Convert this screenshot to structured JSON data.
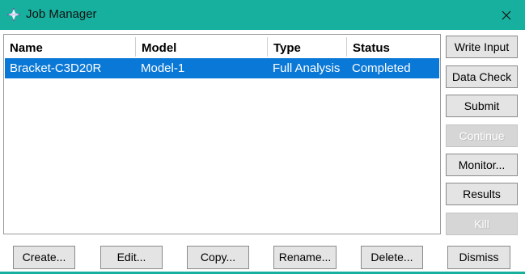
{
  "window": {
    "title": "Job Manager",
    "accent_color": "#17b09e",
    "selection_color": "#0a78d6",
    "app_icon": "abaqus-cross-icon",
    "close_icon": "close-icon"
  },
  "table": {
    "columns": [
      "Name",
      "Model",
      "Type",
      "Status"
    ],
    "rows": [
      {
        "name": "Bracket-C3D20R",
        "model": "Model-1",
        "type": "Full Analysis",
        "status": "Completed",
        "selected": true
      }
    ]
  },
  "side_buttons": [
    {
      "label": "Write Input",
      "enabled": true
    },
    {
      "label": "Data Check",
      "enabled": true
    },
    {
      "label": "Submit",
      "enabled": true
    },
    {
      "label": "Continue",
      "enabled": false
    },
    {
      "label": "Monitor...",
      "enabled": true
    },
    {
      "label": "Results",
      "enabled": true
    },
    {
      "label": "Kill",
      "enabled": false
    }
  ],
  "bottom_buttons": [
    {
      "label": "Create..."
    },
    {
      "label": "Edit..."
    },
    {
      "label": "Copy..."
    },
    {
      "label": "Rename..."
    },
    {
      "label": "Delete..."
    },
    {
      "label": "Dismiss"
    }
  ]
}
